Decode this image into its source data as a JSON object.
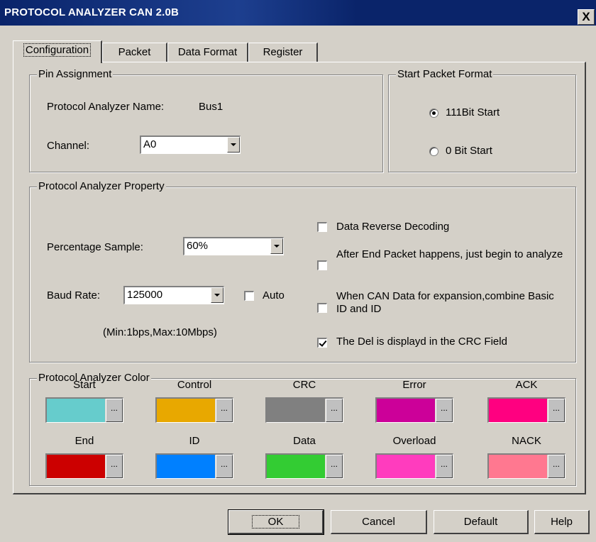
{
  "window": {
    "title": "PROTOCOL ANALYZER CAN 2.0B",
    "close_label": "X"
  },
  "tabs": [
    {
      "label": "Configuration",
      "active": true
    },
    {
      "label": "Packet"
    },
    {
      "label": "Data Format"
    },
    {
      "label": "Register"
    }
  ],
  "pin_assignment": {
    "legend": "Pin Assignment",
    "name_label": "Protocol Analyzer Name:",
    "name_value": "Bus1",
    "channel_label": "Channel:",
    "channel_value": "A0"
  },
  "start_packet_format": {
    "legend": "Start Packet Format",
    "options": [
      {
        "label": "111Bit Start",
        "selected": true
      },
      {
        "label": "0 Bit Start",
        "selected": false
      }
    ]
  },
  "property": {
    "legend": "Protocol Analyzer Property",
    "percentage_label": "Percentage Sample:",
    "percentage_value": "60%",
    "baud_label": "Baud Rate:",
    "baud_value": "125000",
    "auto_label": "Auto",
    "auto_checked": false,
    "range_note": "(Min:1bps,Max:10Mbps)",
    "options": [
      {
        "label": "Data Reverse Decoding",
        "checked": false
      },
      {
        "label": "After End Packet happens, just begin to analyze",
        "checked": false
      },
      {
        "label": "When CAN Data for expansion,combine Basic ID and ID",
        "checked": false
      },
      {
        "label": "The Del is displayd in the CRC Field",
        "checked": true
      }
    ]
  },
  "colors": {
    "legend": "Protocol Analyzer Color",
    "more_label": "...",
    "items": [
      {
        "label": "Start",
        "color": "#66cccc"
      },
      {
        "label": "Control",
        "color": "#e8a800"
      },
      {
        "label": "CRC",
        "color": "#808080"
      },
      {
        "label": "Error",
        "color": "#cc0099"
      },
      {
        "label": "ACK",
        "color": "#ff0080"
      },
      {
        "label": "End",
        "color": "#cc0000"
      },
      {
        "label": "ID",
        "color": "#0080ff"
      },
      {
        "label": "Data",
        "color": "#33cc33"
      },
      {
        "label": "Overload",
        "color": "#ff3cbe"
      },
      {
        "label": "NACK",
        "color": "#ff7890"
      }
    ]
  },
  "buttons": {
    "ok": "OK",
    "cancel": "Cancel",
    "default": "Default",
    "help": "Help"
  }
}
